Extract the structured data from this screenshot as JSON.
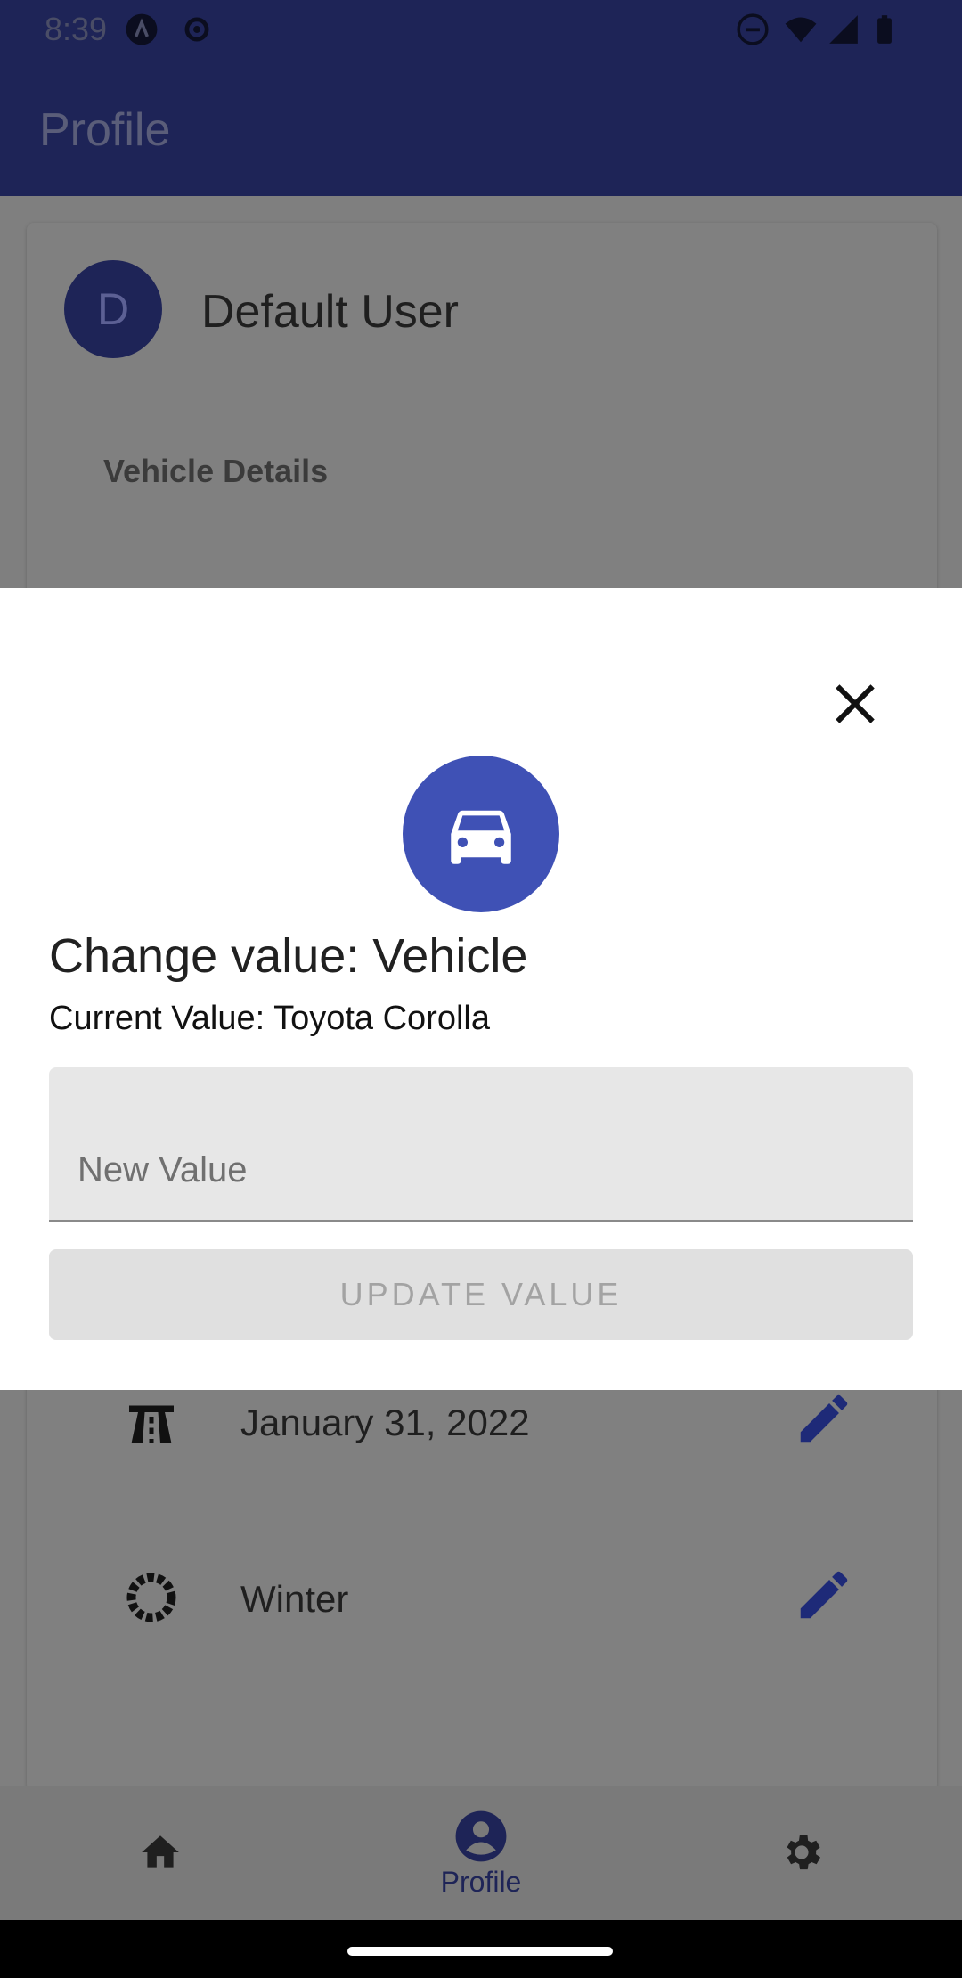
{
  "status_bar": {
    "time": "8:39"
  },
  "app_bar": {
    "title": "Profile"
  },
  "profile": {
    "avatar_letter": "D",
    "name": "Default User",
    "section_title": "Vehicle Details",
    "rows": [
      {
        "icon": "highway-icon",
        "value": "January 31, 2022"
      },
      {
        "icon": "tire-icon",
        "value": "Winter"
      }
    ]
  },
  "modal": {
    "icon": "car-icon",
    "title": "Change value: Vehicle",
    "subtitle": "Current Value: Toyota Corolla",
    "input_placeholder": "New Value",
    "input_value": "",
    "button_label": "UPDATE VALUE"
  },
  "bottom_nav": {
    "items": [
      {
        "icon": "home-icon",
        "label": ""
      },
      {
        "icon": "account-icon",
        "label": "Profile",
        "selected": true
      },
      {
        "icon": "gear-icon",
        "label": ""
      }
    ]
  },
  "colors": {
    "app_bar": "#1e2457",
    "accent": "#3f51b5",
    "scrim": "#7f7f7f"
  }
}
